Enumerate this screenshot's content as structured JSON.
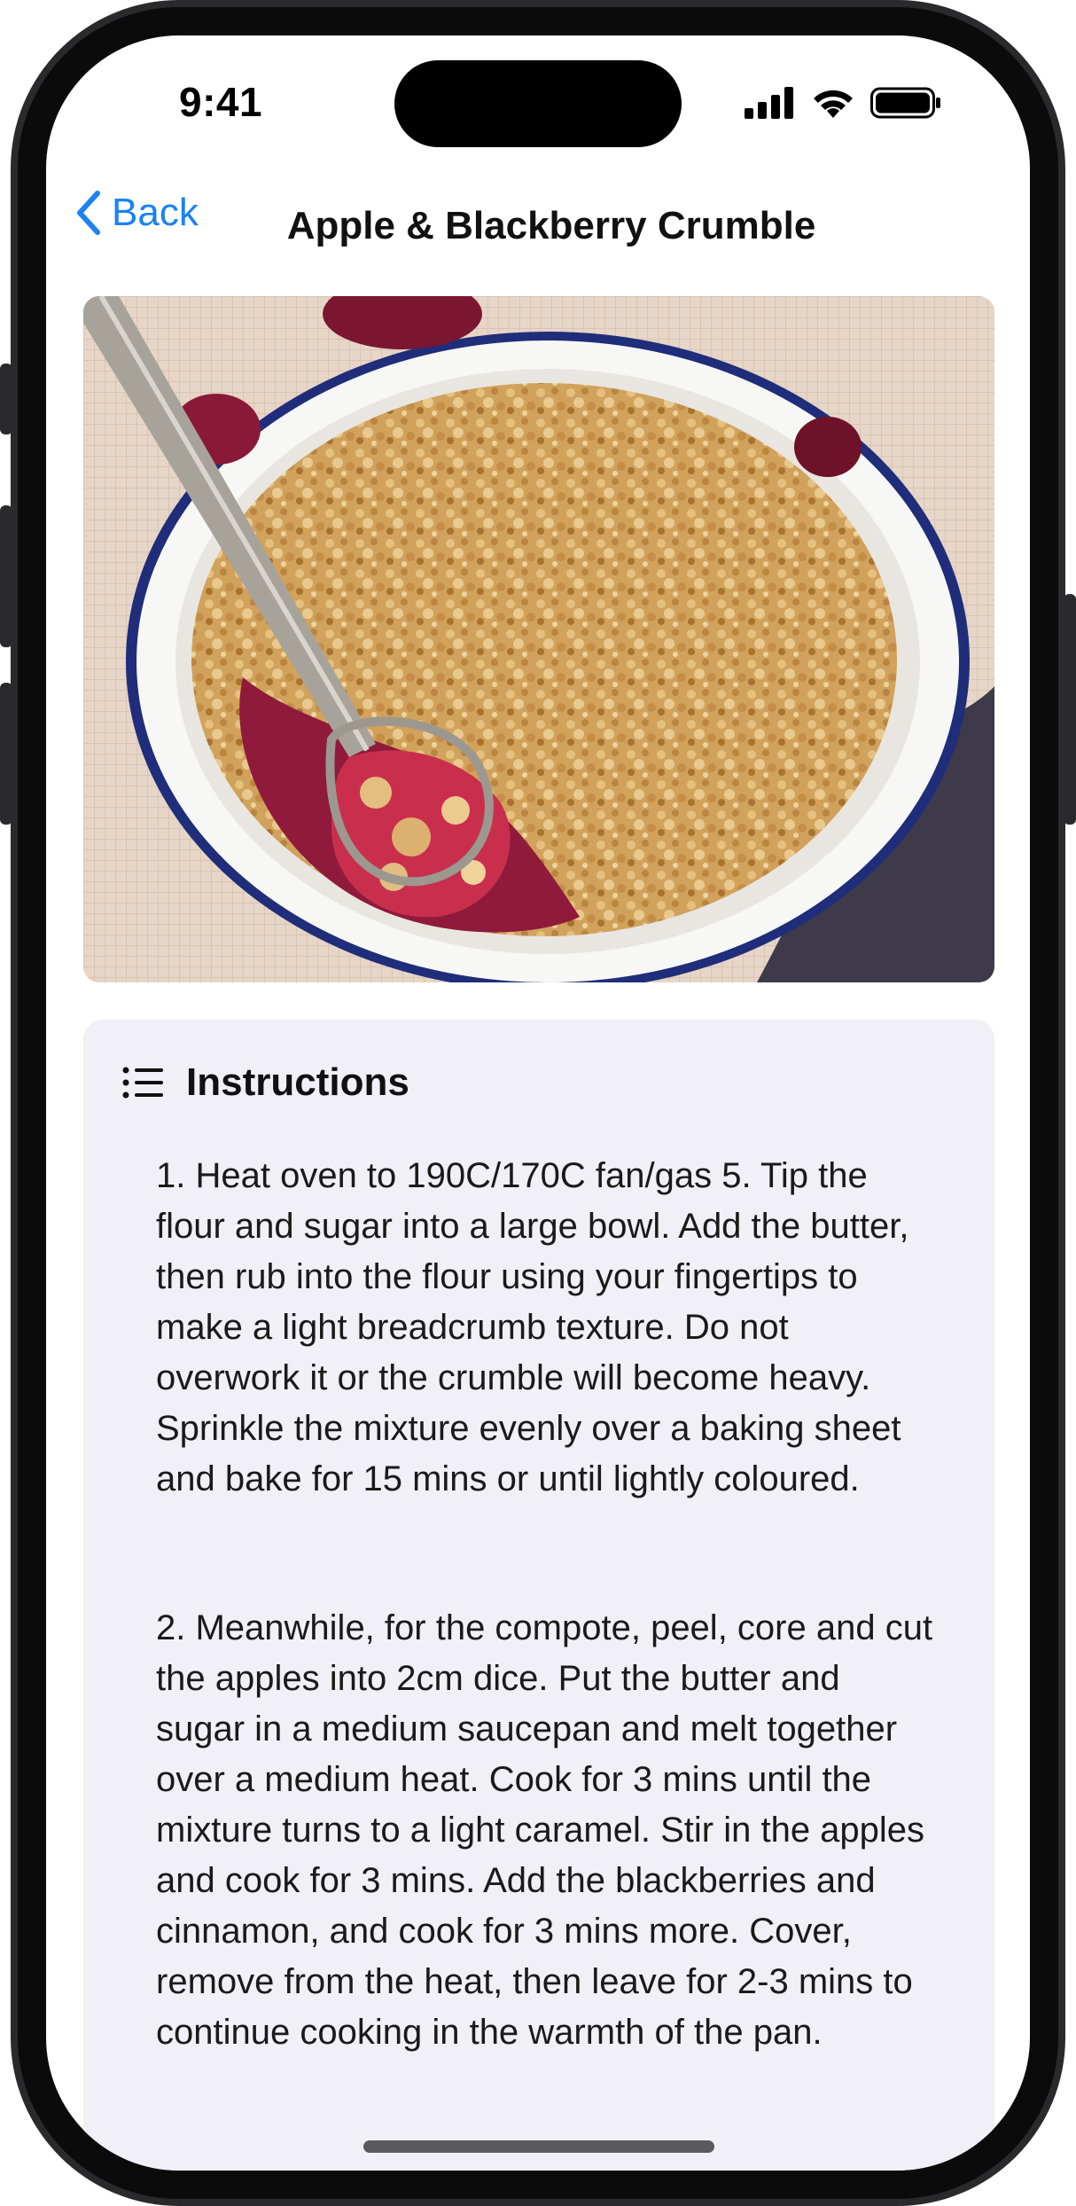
{
  "status_bar": {
    "time": "9:41"
  },
  "nav": {
    "back_label": "Back",
    "title": "Apple & Blackberry Crumble"
  },
  "image": {
    "alt": "Apple and blackberry crumble in an enamel dish with a spoon"
  },
  "instructions": {
    "heading": "Instructions",
    "steps": [
      "1. Heat oven to 190C/170C fan/gas 5. Tip the flour and sugar into a large bowl. Add the butter, then rub into the flour using your fingertips to make a light breadcrumb texture. Do not overwork it or the crumble will become heavy. Sprinkle the mixture evenly over a baking sheet and bake for 15 mins or until lightly coloured.",
      "2. Meanwhile, for the compote, peel, core and cut the apples into 2cm dice. Put the butter and sugar in a medium saucepan and melt together over a medium heat. Cook for 3 mins until the mixture turns to a light caramel. Stir in the apples and cook for 3 mins. Add the blackberries and cinnamon, and cook for 3 mins more. Cover, remove from the heat, then leave for 2-3 mins to continue cooking in the warmth of the pan."
    ]
  },
  "colors": {
    "accent": "#1a82f2",
    "card_bg": "#f1f0f6"
  }
}
